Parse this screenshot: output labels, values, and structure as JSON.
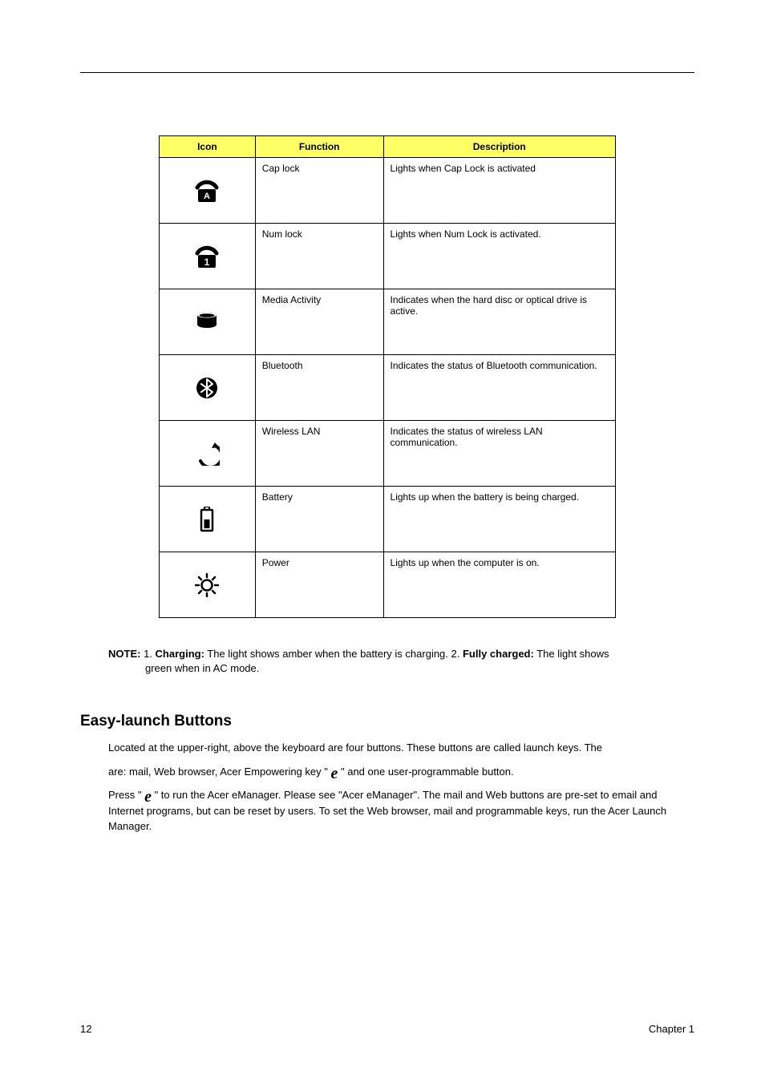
{
  "table": {
    "headers": {
      "icon": "Icon",
      "function": "Function",
      "description": "Description"
    },
    "rows": [
      {
        "function": "Cap lock",
        "description": "Lights when Cap Lock is activated"
      },
      {
        "function": "Num lock",
        "description": "Lights when Num Lock is activated."
      },
      {
        "function": "Media Activity",
        "description": "Indicates when the hard disc or optical drive is active."
      },
      {
        "function": "Bluetooth",
        "description": "Indicates the status of Bluetooth communication."
      },
      {
        "function": "Wireless LAN",
        "description": "Indicates the status of wireless LAN communication."
      },
      {
        "function": "Battery",
        "description": "Lights up when the battery is being charged."
      },
      {
        "function": "Power",
        "description": "Lights up when the computer is on."
      }
    ]
  },
  "note": {
    "prefix": "NOTE: ",
    "line1a": "1. ",
    "line1b": "Charging:",
    "line1c": " The light shows amber when the battery is charging. 2. ",
    "line1d": "Fully charged:",
    "line1e": " The light shows",
    "line2": "green when in AC mode."
  },
  "section": {
    "heading": "Easy-launch Buttons",
    "p1a": "Located at the upper-right, above the keyboard are four buttons. These buttons are called launch keys. The",
    "p1b_pre": "are: mail, Web browser, Acer Empowering key \" ",
    "p1b_post": "  \" and one user-programmable button.",
    "p2a_pre": "Press \" ",
    "p2a_post": "  \" to run the Acer eManager. Please see \"Acer eManager\". The mail and Web buttons are pre-set to email and Internet programs, but can be reset by users. To set the Web browser, mail and programmable keys, run the Acer Launch Manager."
  },
  "footer": {
    "page": "12",
    "chapter": "Chapter 1"
  }
}
